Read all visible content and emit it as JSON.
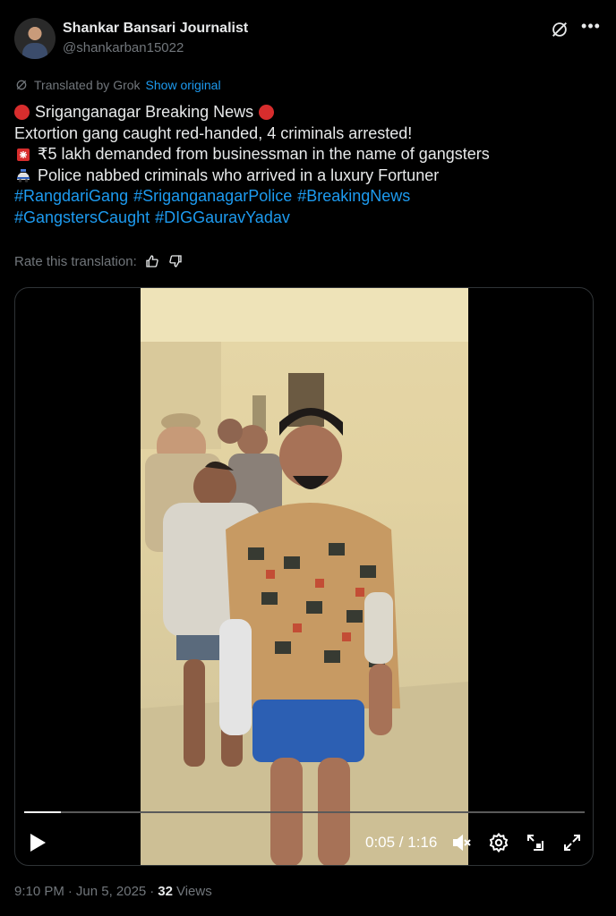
{
  "author": {
    "display_name": "Shankar Bansari Journalist",
    "handle": "@shankarban15022"
  },
  "translation": {
    "label": "Translated by Grok",
    "show_original": "Show original",
    "rate_label": "Rate this translation:"
  },
  "tweet": {
    "line1": "Sriganganagar Breaking News",
    "line2": "Extortion gang caught red-handed, 4 criminals arrested!",
    "line3": "₹5 lakh demanded from businessman in the name of gangsters",
    "line4": "Police nabbed criminals who arrived in a luxury Fortuner",
    "hashtags_line1": [
      "#RangdariGang",
      "#SriganganagarPolice",
      "#BreakingNews"
    ],
    "hashtags_line2": [
      "#GangstersCaught",
      "#DIGGauravYadav"
    ]
  },
  "video": {
    "current_time": "0:05",
    "duration": "1:16",
    "time_display": "0:05 / 1:16",
    "progress_fraction": 0.066
  },
  "meta": {
    "time": "9:10 PM",
    "date": "Jun 5, 2025",
    "views_count": "32",
    "views_label": "Views"
  },
  "colors": {
    "accent": "#1d9bf0",
    "text": "#e7e9ea",
    "muted": "#71767b",
    "background": "#000000"
  },
  "icons": [
    "grok-icon",
    "more-icon",
    "translate-icon",
    "thumbs-up-icon",
    "thumbs-down-icon",
    "red-circle-icon",
    "siren-icon",
    "police-car-icon",
    "play-icon",
    "mute-icon",
    "settings-icon",
    "pip-icon",
    "fullscreen-icon"
  ]
}
